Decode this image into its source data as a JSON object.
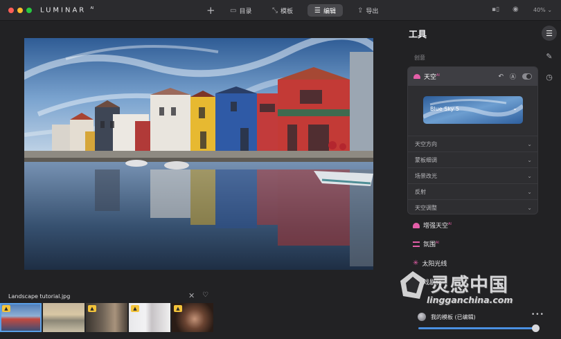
{
  "titlebar": {
    "app_name": "LUMINAR",
    "app_sup": "AI",
    "nav": [
      {
        "icon": "folder-icon",
        "label": "目录"
      },
      {
        "icon": "template-icon",
        "label": "模板"
      },
      {
        "icon": "sliders-icon",
        "label": "编辑",
        "active": true
      },
      {
        "icon": "export-icon",
        "label": "导出"
      }
    ],
    "zoom": "40%"
  },
  "filmstrip": {
    "filename": "Landscape tutorial.jpg",
    "thumbnail_count": 5
  },
  "panel": {
    "title": "工具",
    "section": "创意",
    "sky_tool": {
      "name": "天空",
      "badge": "AI",
      "selected_sky": "Blue Sky 5",
      "subsections": [
        "天空方向",
        "蒙板细调",
        "场景改光",
        "反射",
        "天空调整"
      ]
    },
    "tools": [
      {
        "name": "增强天空",
        "badge": "AI"
      },
      {
        "name": "氛围",
        "badge": "AI"
      },
      {
        "name": "太阳光线",
        "badge": ""
      },
      {
        "name": "戏剧化",
        "badge": ""
      }
    ],
    "preset": {
      "name": "我的模板 (已编辑)",
      "slider_value": 1.0
    }
  },
  "watermark": {
    "cn": "灵感中国",
    "en": "lingganchina.com"
  },
  "colors": {
    "accent": "#4a90e2",
    "ai_pink": "#e45ea8",
    "badge_yellow": "#f3c33a"
  }
}
